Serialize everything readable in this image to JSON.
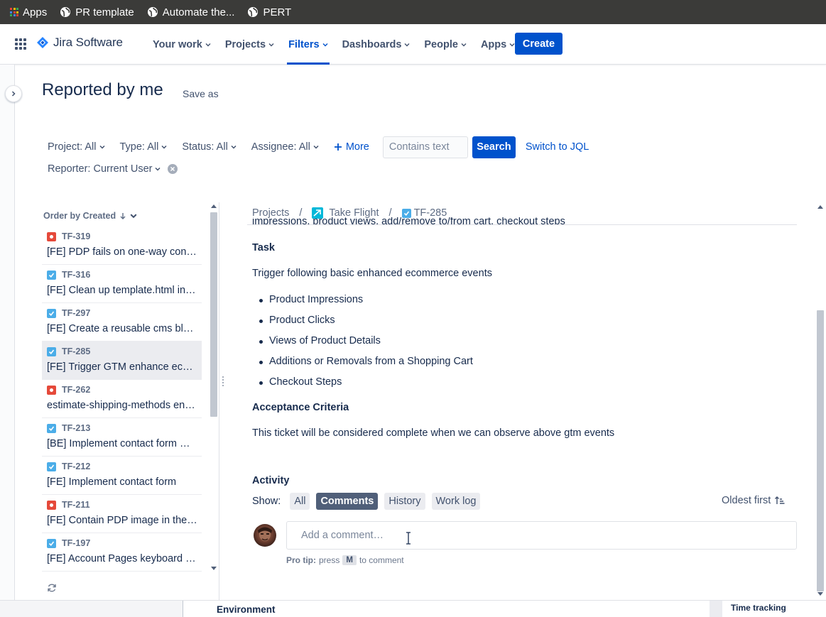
{
  "bookmarks": [
    {
      "label": "Apps",
      "icon": "apps-grid-icon"
    },
    {
      "label": "PR template",
      "icon": "globe-icon"
    },
    {
      "label": "Automate the...",
      "icon": "globe-icon"
    },
    {
      "label": "PERT",
      "icon": "globe-icon"
    }
  ],
  "topnav": {
    "product": "Jira Software",
    "items": [
      "Your work",
      "Projects",
      "Filters",
      "Dashboards",
      "People",
      "Apps"
    ],
    "active": "Filters",
    "create_label": "Create"
  },
  "page": {
    "title": "Reported by me",
    "save_as": "Save as"
  },
  "filters": {
    "project": "Project: All",
    "type": "Type: All",
    "status": "Status: All",
    "assignee": "Assignee: All",
    "more": "More",
    "search_placeholder": "Contains text",
    "search_label": "Search",
    "jql_label": "Switch to JQL",
    "reporter": "Reporter: Current User"
  },
  "issue_list": {
    "order_label": "Order by Created",
    "items": [
      {
        "type": "bug",
        "key": "TF-319",
        "summary": "[FE] PDP fails on one-way confi…"
      },
      {
        "type": "task",
        "key": "TF-316",
        "summary": "[FE] Clean up template.html in …"
      },
      {
        "type": "task",
        "key": "TF-297",
        "summary": "[FE] Create a reusable cms bloc…"
      },
      {
        "type": "task",
        "key": "TF-285",
        "summary": "[FE] Trigger GTM enhance eco…",
        "selected": true
      },
      {
        "type": "bug",
        "key": "TF-262",
        "summary": "estimate-shipping-methods en…"
      },
      {
        "type": "task",
        "key": "TF-213",
        "summary": "[BE] Implement contact form m…"
      },
      {
        "type": "task",
        "key": "TF-212",
        "summary": "[FE] Implement contact form"
      },
      {
        "type": "bug",
        "key": "TF-211",
        "summary": "[FE] Contain PDP image in the …"
      },
      {
        "type": "task",
        "key": "TF-197",
        "summary": "[FE] Account Pages keyboard n…"
      }
    ]
  },
  "detail": {
    "breadcrumb": {
      "projects": "Projects",
      "project": "Take Flight",
      "issue": "TF-285"
    },
    "cut_line": "impressions, product views, add/remove to/from cart, checkout steps",
    "task_heading": "Task",
    "task_text": "Trigger following basic enhanced ecommerce events",
    "bullets": [
      "Product Impressions",
      "Product Clicks",
      "Views of Product Details",
      "Additions or Removals from a Shopping Cart",
      "Checkout Steps"
    ],
    "ac_heading": "Acceptance Criteria",
    "ac_text": "This ticket will be considered complete when we can observe above gtm events",
    "activity": {
      "heading": "Activity",
      "show_label": "Show:",
      "tabs": [
        "All",
        "Comments",
        "History",
        "Work log"
      ],
      "active_tab": "Comments",
      "sort_label": "Oldest first",
      "comment_placeholder": "Add a comment…",
      "protip_label": "Pro tip:",
      "protip_press": "press",
      "protip_key": "M",
      "protip_tail": "to comment"
    }
  },
  "background": {
    "environment": "Environment",
    "time_tracking": "Time tracking"
  },
  "colors": {
    "brand": "#0052cc",
    "bug": "#e5493a",
    "task": "#4bade8"
  }
}
